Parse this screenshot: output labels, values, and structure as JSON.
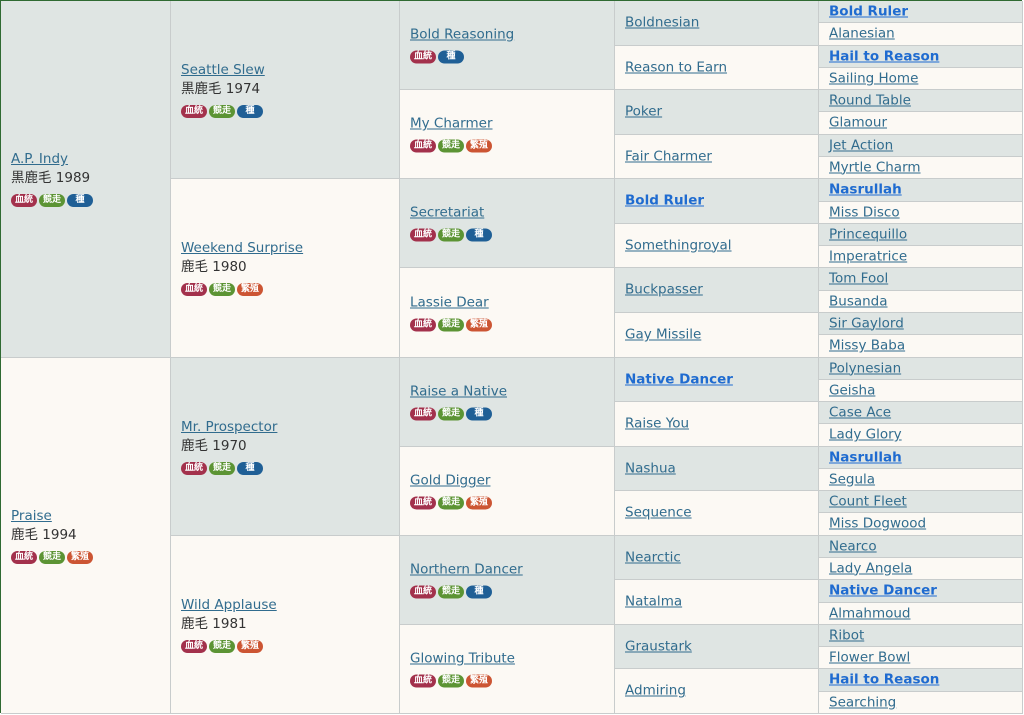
{
  "badge_labels": {
    "blood": "血統",
    "race": "競走",
    "sire": "種",
    "broodmare": "繁殖"
  },
  "colors": {
    "gray_cell": "#dfe5e3",
    "cream_cell": "#fcf9f4",
    "link": "#316c8e",
    "link_bold": "#1f6bd0",
    "badge_blood": "#a3314c",
    "badge_race": "#5c9434",
    "badge_sire": "#1f5f96",
    "badge_broodmare": "#cc5533",
    "border": "#2f6a32"
  },
  "gen1": [
    {
      "name": "A.P. Indy",
      "info": "黒鹿毛 1989",
      "badges": [
        "blood",
        "race",
        "sire"
      ]
    },
    {
      "name": "Praise",
      "info": "鹿毛 1994",
      "badges": [
        "blood",
        "race",
        "broodmare"
      ]
    }
  ],
  "gen2": [
    {
      "name": "Seattle Slew",
      "info": "黒鹿毛 1974",
      "badges": [
        "blood",
        "race",
        "sire"
      ]
    },
    {
      "name": "Weekend Surprise",
      "info": "鹿毛 1980",
      "badges": [
        "blood",
        "race",
        "broodmare"
      ]
    },
    {
      "name": "Mr. Prospector",
      "info": "鹿毛 1970",
      "badges": [
        "blood",
        "race",
        "sire"
      ]
    },
    {
      "name": "Wild Applause",
      "info": "鹿毛 1981",
      "badges": [
        "blood",
        "race",
        "broodmare"
      ]
    }
  ],
  "gen3": [
    {
      "name": "Bold Reasoning",
      "badges": [
        "blood",
        "sire"
      ]
    },
    {
      "name": "My Charmer",
      "badges": [
        "blood",
        "race",
        "broodmare"
      ]
    },
    {
      "name": "Secretariat",
      "badges": [
        "blood",
        "race",
        "sire"
      ]
    },
    {
      "name": "Lassie Dear",
      "badges": [
        "blood",
        "race",
        "broodmare"
      ]
    },
    {
      "name": "Raise a Native",
      "badges": [
        "blood",
        "race",
        "sire"
      ]
    },
    {
      "name": "Gold Digger",
      "badges": [
        "blood",
        "race",
        "broodmare"
      ]
    },
    {
      "name": "Northern Dancer",
      "badges": [
        "blood",
        "race",
        "sire"
      ]
    },
    {
      "name": "Glowing Tribute",
      "badges": [
        "blood",
        "race",
        "broodmare"
      ]
    }
  ],
  "gen4": [
    {
      "name": "Boldnesian",
      "bold": false
    },
    {
      "name": "Reason to Earn",
      "bold": false
    },
    {
      "name": "Poker",
      "bold": false
    },
    {
      "name": "Fair Charmer",
      "bold": false
    },
    {
      "name": "Bold Ruler",
      "bold": true
    },
    {
      "name": "Somethingroyal",
      "bold": false
    },
    {
      "name": "Buckpasser",
      "bold": false
    },
    {
      "name": "Gay Missile",
      "bold": false
    },
    {
      "name": "Native Dancer",
      "bold": true
    },
    {
      "name": "Raise You",
      "bold": false
    },
    {
      "name": "Nashua",
      "bold": false
    },
    {
      "name": "Sequence",
      "bold": false
    },
    {
      "name": "Nearctic",
      "bold": false
    },
    {
      "name": "Natalma",
      "bold": false
    },
    {
      "name": "Graustark",
      "bold": false
    },
    {
      "name": "Admiring",
      "bold": false
    }
  ],
  "gen5": [
    {
      "name": "Bold Ruler",
      "bold": true
    },
    {
      "name": "Alanesian",
      "bold": false
    },
    {
      "name": "Hail to Reason",
      "bold": true
    },
    {
      "name": "Sailing Home",
      "bold": false
    },
    {
      "name": "Round Table",
      "bold": false
    },
    {
      "name": "Glamour",
      "bold": false
    },
    {
      "name": "Jet Action",
      "bold": false
    },
    {
      "name": "Myrtle Charm",
      "bold": false
    },
    {
      "name": "Nasrullah",
      "bold": true
    },
    {
      "name": "Miss Disco",
      "bold": false
    },
    {
      "name": "Princequillo",
      "bold": false
    },
    {
      "name": "Imperatrice",
      "bold": false
    },
    {
      "name": "Tom Fool",
      "bold": false
    },
    {
      "name": "Busanda",
      "bold": false
    },
    {
      "name": "Sir Gaylord",
      "bold": false
    },
    {
      "name": "Missy Baba",
      "bold": false
    },
    {
      "name": "Polynesian",
      "bold": false
    },
    {
      "name": "Geisha",
      "bold": false
    },
    {
      "name": "Case Ace",
      "bold": false
    },
    {
      "name": "Lady Glory",
      "bold": false
    },
    {
      "name": "Nasrullah",
      "bold": true
    },
    {
      "name": "Segula",
      "bold": false
    },
    {
      "name": "Count Fleet",
      "bold": false
    },
    {
      "name": "Miss Dogwood",
      "bold": false
    },
    {
      "name": "Nearco",
      "bold": false
    },
    {
      "name": "Lady Angela",
      "bold": false
    },
    {
      "name": "Native Dancer",
      "bold": true
    },
    {
      "name": "Almahmoud",
      "bold": false
    },
    {
      "name": "Ribot",
      "bold": false
    },
    {
      "name": "Flower Bowl",
      "bold": false
    },
    {
      "name": "Hail to Reason",
      "bold": true
    },
    {
      "name": "Searching",
      "bold": false
    }
  ]
}
